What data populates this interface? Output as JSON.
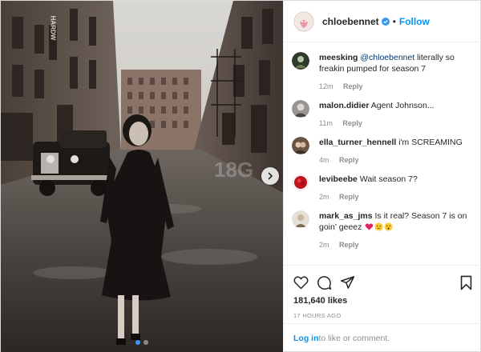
{
  "post": {
    "username": "chloebennet",
    "separator": "•",
    "follow_label": "Follow",
    "views": "181,640 likes",
    "timestamp": "17 HOURS AGO"
  },
  "comments": [
    {
      "username": "meesking",
      "mention": "@chloebennet",
      "text": " literally so freakin pumped for season 7",
      "age": "12m",
      "reply": "Reply"
    },
    {
      "username": "malon.didier",
      "mention": "",
      "text": "Agent Johnson...",
      "age": "11m",
      "reply": "Reply"
    },
    {
      "username": "ella_turner_hennell",
      "mention": "",
      "text": "i'm SCREAMING",
      "age": "4m",
      "reply": "Reply"
    },
    {
      "username": "levibeebe",
      "mention": "",
      "text": "Wait season 7?",
      "age": "2m",
      "reply": "Reply"
    },
    {
      "username": "mark_as_jms",
      "mention": "",
      "text": "Is it real? Season 7 is on goin' geeez",
      "age": "2m",
      "reply": "Reply"
    }
  ],
  "photo": {
    "shop_sign": "HARDW"
  },
  "login_bar": {
    "login_label": "Log in",
    "rest_text": " to like or comment."
  },
  "icons": {
    "like": "heart-icon",
    "comment": "comment-icon",
    "share": "share-icon",
    "save": "bookmark-icon",
    "next": "chevron-right-icon",
    "verified": "verified-badge-icon"
  },
  "colors": {
    "link_blue": "#0095f6",
    "mention_blue": "#00376b",
    "muted": "#8e8e8e",
    "carousel_active": "#3897f0"
  }
}
